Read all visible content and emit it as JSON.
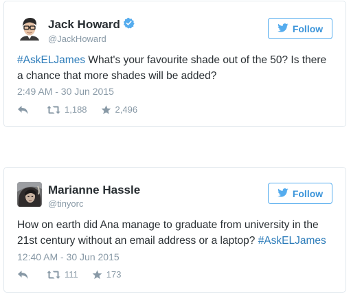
{
  "tweets": [
    {
      "display_name": "Jack Howard",
      "handle": "@JackHoward",
      "verified": true,
      "follow_label": "Follow",
      "text_hashtag": "#AskELJames",
      "text_body": " What's your favourite shade out of the 50? Is there a chance that more shades will be added?",
      "timestamp": "2:49 AM - 30 Jun 2015",
      "retweets": "1,188",
      "favorites": "2,496"
    },
    {
      "display_name": "Marianne Hassle",
      "handle": "@tinyorc",
      "verified": false,
      "follow_label": "Follow",
      "text_body": "How on earth did Ana manage to graduate from university in the 21st century without an email address or a laptop? ",
      "text_hashtag": "#AskELJames",
      "timestamp": "12:40 AM - 30 Jun 2015",
      "retweets": "111",
      "favorites": "173"
    }
  ],
  "icons": {
    "verified": "verified-badge-icon",
    "follow": "twitter-bird-icon",
    "reply": "reply-icon",
    "retweet": "retweet-icon",
    "favorite": "star-icon"
  },
  "colors": {
    "link": "#2b7bb9",
    "follow_border": "#55acee",
    "follow_text": "#3b94d9",
    "muted": "#8899a6",
    "card_border": "#e1e8ed"
  }
}
